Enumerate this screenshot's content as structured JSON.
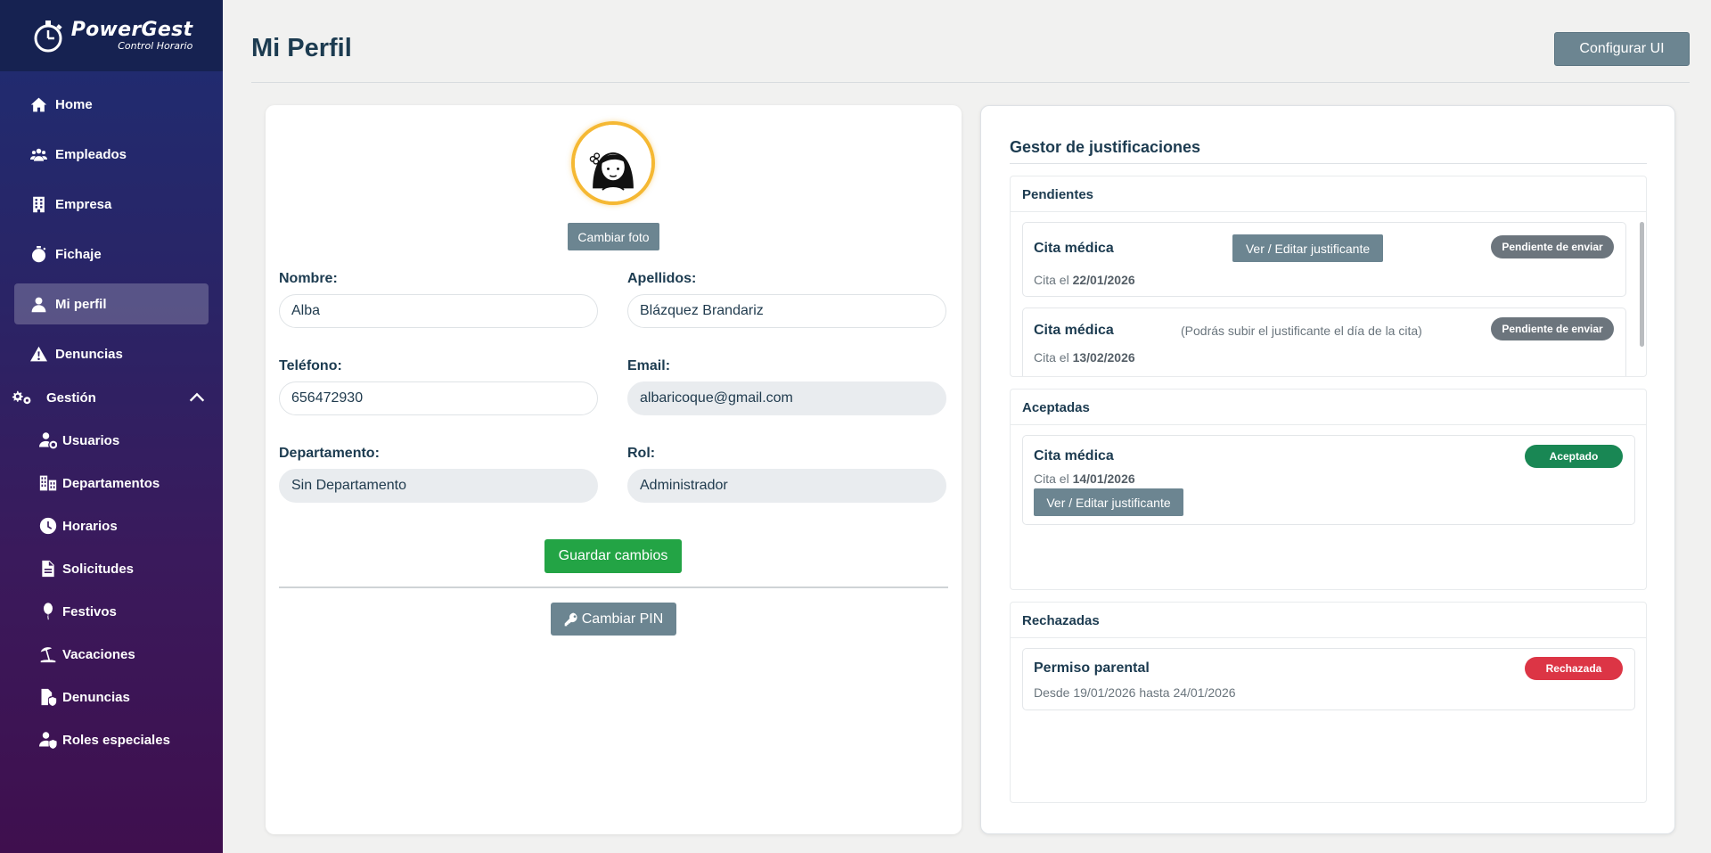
{
  "app": {
    "logo_title": "PowerGest",
    "logo_subtitle": "Control Horario"
  },
  "sidebar": {
    "items": [
      {
        "label": "Home",
        "icon": "home-icon"
      },
      {
        "label": "Empleados",
        "icon": "users-icon"
      },
      {
        "label": "Empresa",
        "icon": "building-icon"
      },
      {
        "label": "Fichaje",
        "icon": "stopwatch-icon"
      },
      {
        "label": "Mi perfil",
        "icon": "user-icon"
      },
      {
        "label": "Denuncias",
        "icon": "warning-icon"
      }
    ],
    "gestion_label": "Gestión",
    "sub_items": [
      {
        "label": "Usuarios",
        "icon": "user-cog-icon"
      },
      {
        "label": "Departamentos",
        "icon": "departments-icon"
      },
      {
        "label": "Horarios",
        "icon": "clock-icon"
      },
      {
        "label": "Solicitudes",
        "icon": "document-icon"
      },
      {
        "label": "Festivos",
        "icon": "balloon-icon"
      },
      {
        "label": "Vacaciones",
        "icon": "umbrella-beach-icon"
      },
      {
        "label": "Denuncias",
        "icon": "file-shield-icon"
      },
      {
        "label": "Roles especiales",
        "icon": "user-shield-icon"
      }
    ]
  },
  "header": {
    "title": "Mi Perfil",
    "config_button": "Configurar UI"
  },
  "profile": {
    "change_photo": "Cambiar foto",
    "fields": {
      "nombre_label": "Nombre:",
      "nombre_value": "Alba",
      "apellidos_label": "Apellidos:",
      "apellidos_value": "Blázquez Brandariz",
      "telefono_label": "Teléfono:",
      "telefono_value": "656472930",
      "email_label": "Email:",
      "email_value": "albaricoque@gmail.com",
      "departamento_label": "Departamento:",
      "departamento_value": "Sin Departamento",
      "rol_label": "Rol:",
      "rol_value": "Administrador"
    },
    "save_button": "Guardar cambios",
    "pin_button": "Cambiar PIN"
  },
  "justifications": {
    "title": "Gestor de justificaciones",
    "pending": {
      "heading": "Pendientes",
      "items": [
        {
          "title": "Cita médica",
          "date_prefix": "Cita el",
          "date": "22/01/2026",
          "button": "Ver / Editar justificante",
          "badge": "Pendiente de enviar"
        },
        {
          "title": "Cita médica",
          "date_prefix": "Cita el",
          "date": "13/02/2026",
          "note": "(Podrás subir el justificante el día de la cita)",
          "badge": "Pendiente de enviar"
        }
      ]
    },
    "accepted": {
      "heading": "Aceptadas",
      "items": [
        {
          "title": "Cita médica",
          "date_prefix": "Cita el",
          "date": "14/01/2026",
          "button": "Ver / Editar justificante",
          "badge": "Aceptado"
        }
      ]
    },
    "rejected": {
      "heading": "Rechazadas",
      "items": [
        {
          "title": "Permiso parental",
          "range": "Desde 19/01/2026 hasta 24/01/2026",
          "badge": "Rechazada"
        }
      ]
    }
  },
  "colors": {
    "accent_gray_button": "#6c8591",
    "save_green": "#23a445",
    "badge_gray": "#6c757d",
    "badge_green": "#198754",
    "badge_red": "#dc3545",
    "avatar_ring": "#f5b833"
  }
}
